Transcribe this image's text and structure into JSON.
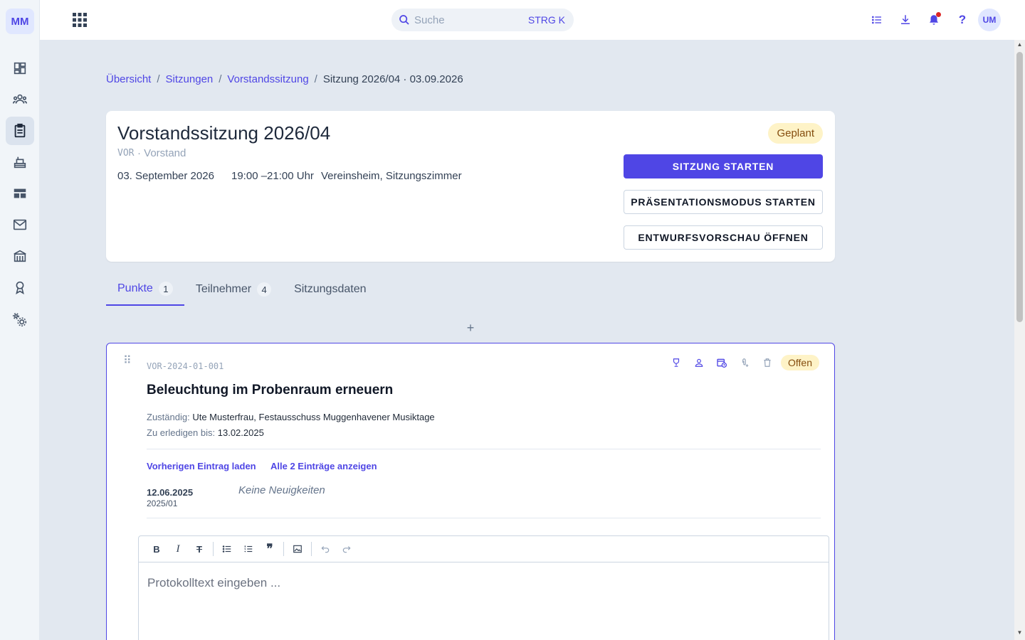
{
  "sidebar": {
    "logo": "MM",
    "items": [
      {
        "icon": "dashboard-icon"
      },
      {
        "icon": "members-icon"
      },
      {
        "icon": "meetings-icon",
        "active": true
      },
      {
        "icon": "inventory-icon"
      },
      {
        "icon": "table-icon"
      },
      {
        "icon": "mail-icon"
      },
      {
        "icon": "building-icon"
      },
      {
        "icon": "award-icon"
      },
      {
        "icon": "settings-icon"
      }
    ]
  },
  "topbar": {
    "search_placeholder": "Suche",
    "search_shortcut": "STRG K",
    "avatar": "UM"
  },
  "breadcrumb": {
    "items": [
      "Übersicht",
      "Sitzungen",
      "Vorstandssitzung"
    ],
    "separator": "/",
    "current": "Sitzung 2026/04 · 03.09.2026"
  },
  "meeting": {
    "title": "Vorstandssitzung 2026/04",
    "code": "VOR",
    "org": "· Vorstand",
    "date": "03. September 2026",
    "time": "19:00 –21:00 Uhr",
    "location": "Vereinsheim, Sitzungszimmer",
    "status": "Geplant",
    "buttons": {
      "start": "SITZUNG STARTEN",
      "presentation": "PRÄSENTATIONSMODUS STARTEN",
      "preview": "ENTWURFSVORSCHAU ÖFFNEN"
    }
  },
  "tabs": [
    {
      "label": "Punkte",
      "count": "1",
      "active": true
    },
    {
      "label": "Teilnehmer",
      "count": "4"
    },
    {
      "label": "Sitzungsdaten",
      "count": ""
    }
  ],
  "add_label": "+",
  "item": {
    "code": "VOR-2024-01-001",
    "status": "Offen",
    "title": "Beleuchtung im Probenraum erneuern",
    "responsible_label": "Zuständig:",
    "responsible": "Ute Musterfrau, Festausschuss Muggenhavener Musiktage",
    "due_label": "Zu erledigen bis:",
    "due": "13.02.2025",
    "load_previous": "Vorherigen Eintrag laden",
    "show_all": "Alle 2 Einträge anzeigen",
    "entry": {
      "date": "12.06.2025",
      "session": "2025/01",
      "text": "Keine Neuigkeiten"
    },
    "editor_placeholder": "Protokolltext eingeben ..."
  },
  "colors": {
    "accent": "#4f46e5",
    "status_bg": "#fef3c7",
    "status_text": "#854d0e",
    "background": "#e2e8f0"
  }
}
